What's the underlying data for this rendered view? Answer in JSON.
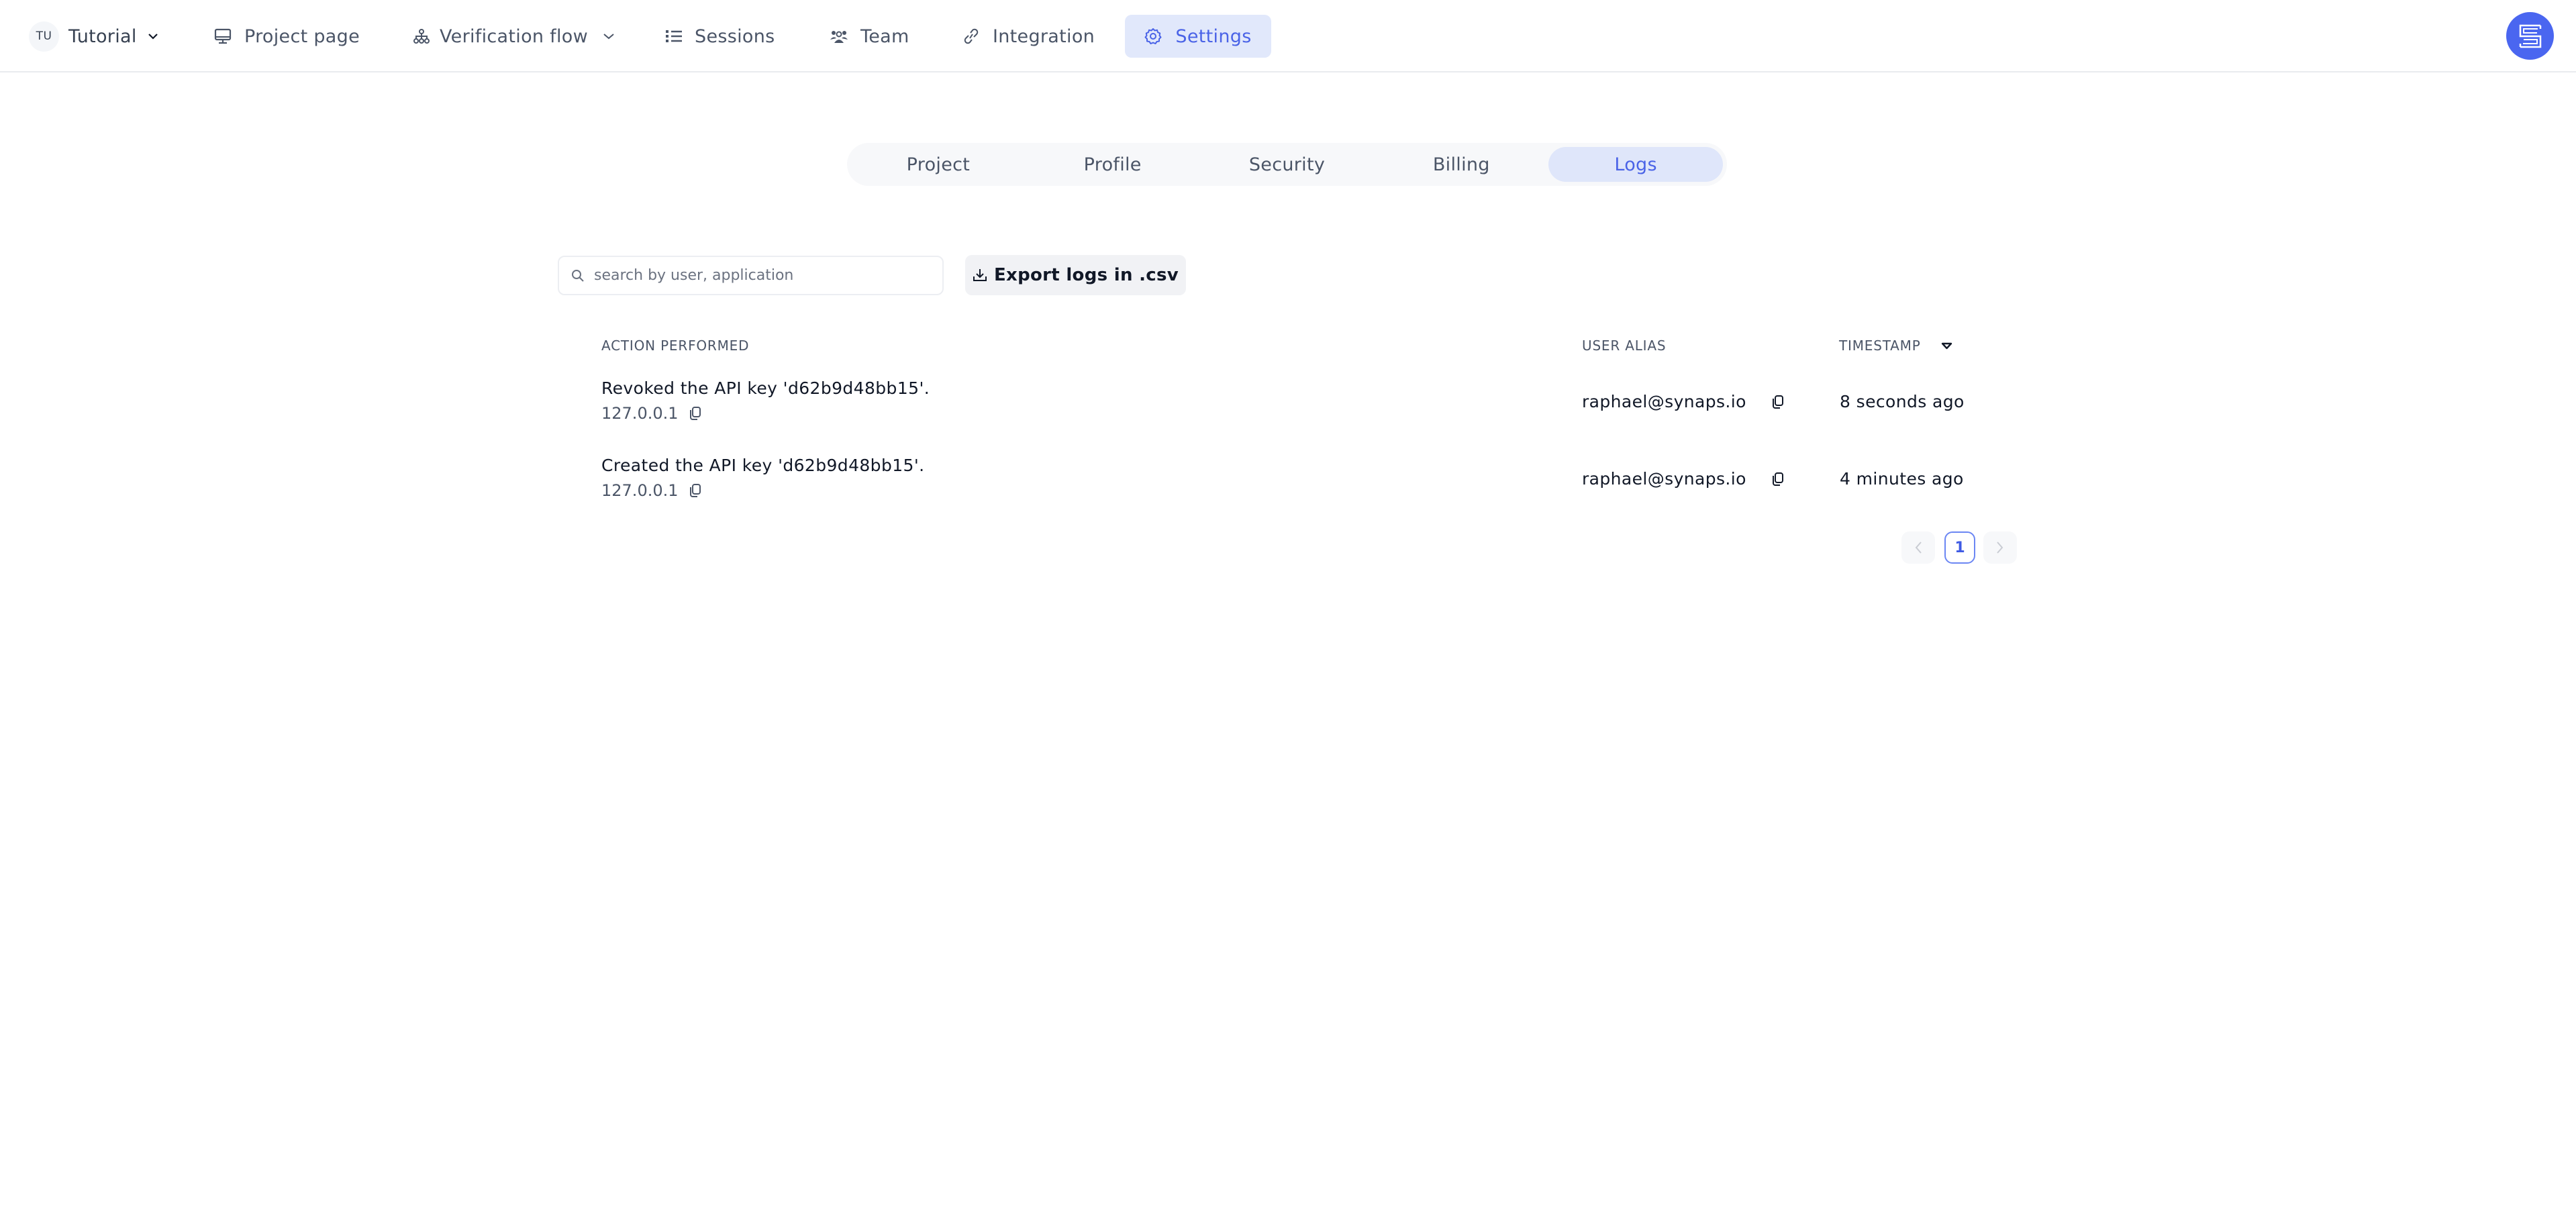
{
  "topnav": {
    "workspace": {
      "initials": "TU",
      "name": "Tutorial"
    },
    "items": [
      {
        "label": "Project page",
        "icon": "monitor-icon"
      },
      {
        "label": "Verification flow",
        "icon": "sitemap-icon",
        "has_dropdown": true
      },
      {
        "label": "Sessions",
        "icon": "list-icon"
      },
      {
        "label": "Team",
        "icon": "team-icon"
      },
      {
        "label": "Integration",
        "icon": "link-icon"
      },
      {
        "label": "Settings",
        "icon": "gear-icon",
        "active": true
      }
    ],
    "logo": "synaps-logo"
  },
  "tabs": [
    {
      "label": "Project",
      "active": false
    },
    {
      "label": "Profile",
      "active": false
    },
    {
      "label": "Security",
      "active": false
    },
    {
      "label": "Billing",
      "active": false
    },
    {
      "label": "Logs",
      "active": true
    }
  ],
  "logs": {
    "search": {
      "placeholder": "search by user, application",
      "value": ""
    },
    "export_label": "Export logs in .csv",
    "columns": {
      "action": "ACTION PERFORMED",
      "user": "USER ALIAS",
      "timestamp": "TIMESTAMP"
    },
    "sort": {
      "column": "timestamp",
      "direction": "desc"
    },
    "rows": [
      {
        "action": "Revoked the API key 'd62b9d48bb15'.",
        "ip": "127.0.0.1",
        "user": "raphael@synaps.io",
        "timestamp": "8 seconds ago"
      },
      {
        "action": "Created the API key 'd62b9d48bb15'.",
        "ip": "127.0.0.1",
        "user": "raphael@synaps.io",
        "timestamp": "4 minutes ago"
      }
    ],
    "pagination": {
      "current_page": "1"
    }
  },
  "colors": {
    "accent": "#4a63e7",
    "accent_bg": "#dfe6fa",
    "logo": "#4a66f0",
    "text_muted": "#4b5567"
  }
}
